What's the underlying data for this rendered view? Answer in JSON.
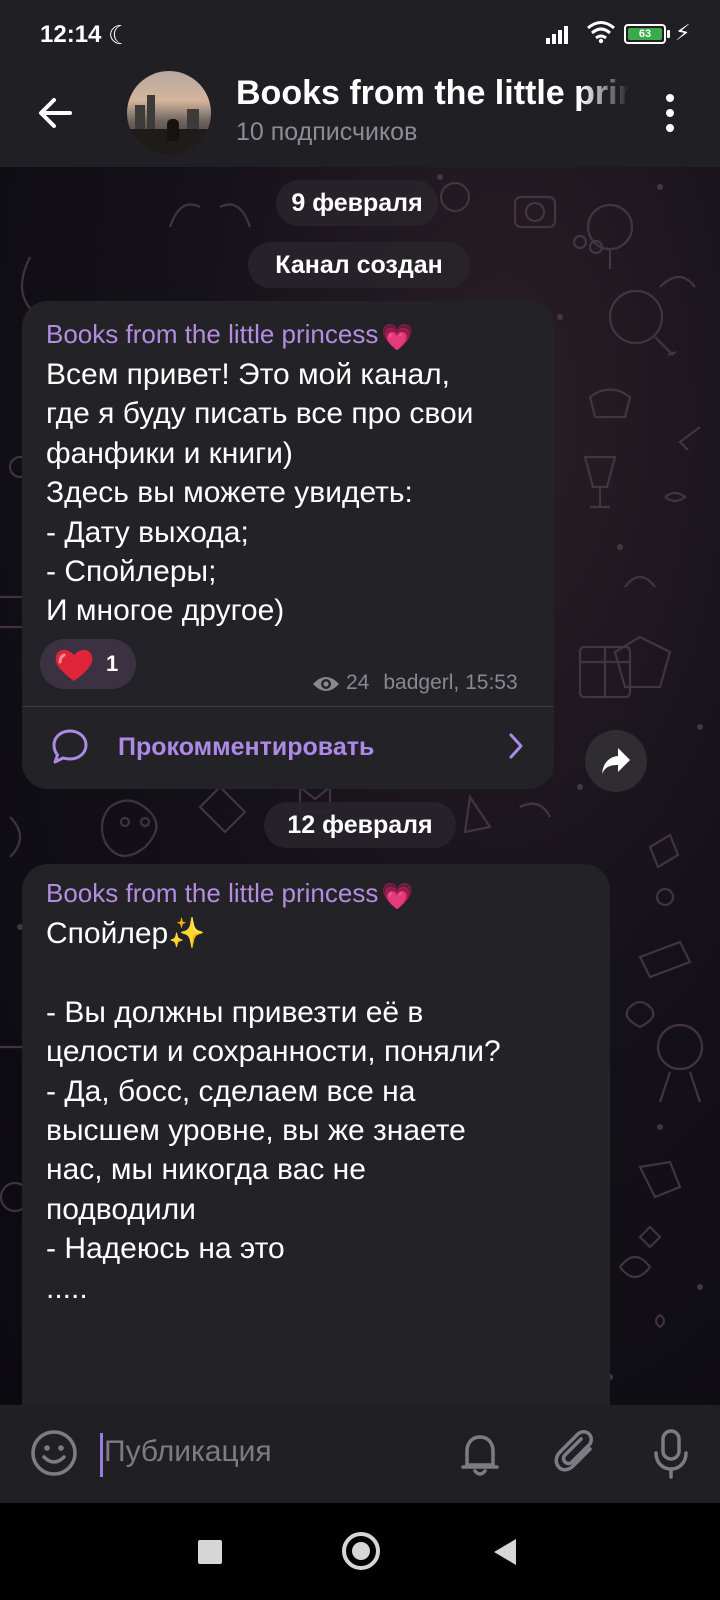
{
  "status_bar": {
    "time": "12:14",
    "battery": "63"
  },
  "header": {
    "channel_title": "Books from the little princess",
    "subscribers": "10 подписчиков"
  },
  "chat": {
    "date_1": "9 февраля",
    "service_message": "Канал создан",
    "date_2": "12 февраля",
    "posts": [
      {
        "author": "Books from the little princess",
        "author_emoji": "💗",
        "text": "Всем привет! Это мой канал,\nгде я буду писать все про свои\nфанфики и книги)\nЗдесь вы можете увидеть:\n- Дату выхода;\n- Спойлеры;\nИ многое другое)",
        "reaction_emoji": "❤️",
        "reaction_count": "1",
        "views": "24",
        "signature_time": "badgerl, 15:53",
        "comment_label": "Прокомментировать"
      },
      {
        "author": "Books from the little princess",
        "author_emoji": "💗",
        "text": "Спойлер✨\n\n- Вы должны привезти её в\nцелости и сохранности, поняли?\n- Да, босс, сделаем все на\nвысшем уровне, вы же знаете\nнас, мы никогда вас не\nподводили\n- Надеюсь на это\n....."
      }
    ]
  },
  "input_bar": {
    "placeholder": "Публикация"
  },
  "icons": {
    "back": "arrow-left-icon",
    "menu": "more-vertical-icon",
    "views": "eye-icon",
    "comment": "comment-bubble-icon",
    "share": "share-arrow-icon",
    "emoji": "smile-icon",
    "bell": "bell-icon",
    "attach": "paperclip-icon",
    "mic": "microphone-icon"
  },
  "colors": {
    "accent": "#b48ce0",
    "header_bg": "#202024",
    "bubble_bg": "#232227",
    "heart": "#e0243a"
  }
}
